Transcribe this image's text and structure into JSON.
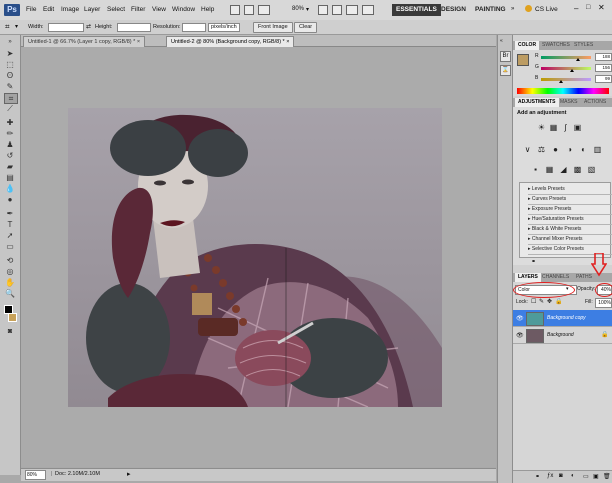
{
  "app": {
    "logo": "Ps"
  },
  "menu": [
    "File",
    "Edit",
    "Image",
    "Layer",
    "Select",
    "Filter",
    "View",
    "Window",
    "Help"
  ],
  "menubar_right": {
    "zoom": "80%",
    "workspaces": [
      "ESSENTIALS",
      "DESIGN",
      "PAINTING"
    ],
    "cs_live": "CS Live"
  },
  "options": {
    "width_label": "Width:",
    "height_label": "Height:",
    "resolution_label": "Resolution:",
    "resolution_unit": "pixels/inch",
    "front_image": "Front Image",
    "clear": "Clear"
  },
  "tabs": [
    {
      "label": "Untitled-1 @ 66.7% (Layer 1 copy, RGB/8) *",
      "active": false
    },
    {
      "label": "Untitled-2 @ 80% (Background copy, RGB/8) *",
      "active": true
    }
  ],
  "status": {
    "zoom": "80%",
    "doc": "Doc: 2.10M/2.10M"
  },
  "panels": {
    "color": {
      "tabs": [
        "COLOR",
        "SWATCHES",
        "STYLES"
      ],
      "channels": [
        {
          "label": "R",
          "value": "188",
          "position": 0.74
        },
        {
          "label": "G",
          "value": "156",
          "position": 0.61
        },
        {
          "label": "B",
          "value": "99",
          "position": 0.39
        }
      ],
      "fg_color": "#bc9c63"
    },
    "adjustments": {
      "tabs": [
        "ADJUSTMENTS",
        "MASKS",
        "ACTIONS"
      ],
      "heading": "Add an adjustment",
      "row1_icons": [
        "☀",
        "▦",
        "∫",
        "▣",
        "▽"
      ],
      "row2_icons": [
        "∨",
        "⚖",
        "●",
        "◑",
        "◐",
        "▥"
      ],
      "row3_icons": [
        "▪",
        "▦",
        "◢",
        "▩",
        "▧"
      ],
      "presets": [
        "Levels Presets",
        "Curves Presets",
        "Exposure Presets",
        "Hue/Saturation Presets",
        "Black & White Presets",
        "Channel Mixer Presets",
        "Selective Color Presets"
      ]
    },
    "layers": {
      "tabs": [
        "LAYERS",
        "CHANNELS",
        "PATHS"
      ],
      "blend_mode": "Color",
      "opacity_label": "Opacity:",
      "opacity": "40%",
      "lock_label": "Lock:",
      "fill_label": "Fill:",
      "fill": "100%",
      "items": [
        {
          "name": "Background copy",
          "selected": true,
          "thumb": "#4e9b9a"
        },
        {
          "name": "Background",
          "selected": false,
          "thumb": "#6d5a63"
        }
      ]
    }
  },
  "accent": "#3d7ee3",
  "annotation_color": "#e02020"
}
